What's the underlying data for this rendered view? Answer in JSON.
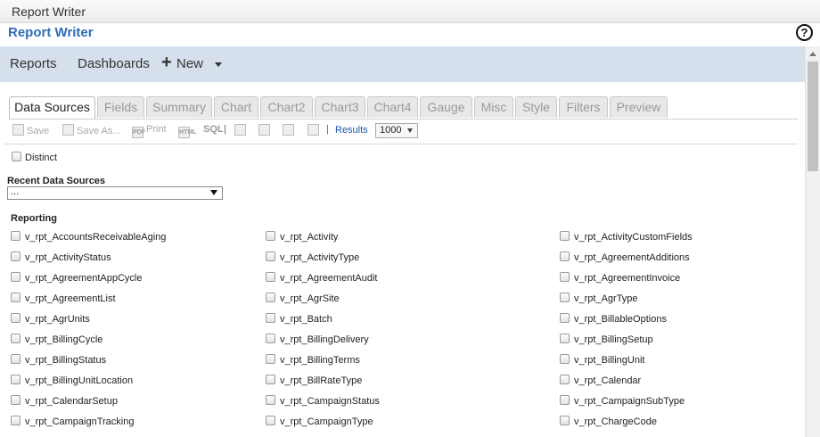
{
  "window": {
    "title": "Report Writer"
  },
  "app": {
    "title": "Report Writer",
    "help_glyph": "?"
  },
  "nav": {
    "reports": "Reports",
    "dashboards": "Dashboards",
    "new_plus": "+",
    "new": "New"
  },
  "tabs": [
    "Data Sources",
    "Fields",
    "Summary",
    "Chart",
    "Chart2",
    "Chart3",
    "Chart4",
    "Gauge",
    "Misc",
    "Style",
    "Filters",
    "Preview"
  ],
  "active_tab": "Data Sources",
  "toolbar": {
    "save": "Save",
    "save_as": "Save As...",
    "print": "Print",
    "sql": "SQL",
    "pdf": "PDF",
    "html": "HTML",
    "separator": "|",
    "results": "Results",
    "results_value": "1000"
  },
  "distinct": {
    "label": "Distinct"
  },
  "recent": {
    "label": "Recent Data Sources",
    "value": "..."
  },
  "reporting": {
    "label": "Reporting",
    "col1": [
      "v_rpt_AccountsReceivableAging",
      "v_rpt_ActivityStatus",
      "v_rpt_AgreementAppCycle",
      "v_rpt_AgreementList",
      "v_rpt_AgrUnits",
      "v_rpt_BillingCycle",
      "v_rpt_BillingStatus",
      "v_rpt_BillingUnitLocation",
      "v_rpt_CalendarSetup",
      "v_rpt_CampaignTracking"
    ],
    "col2": [
      "v_rpt_Activity",
      "v_rpt_ActivityType",
      "v_rpt_AgreementAudit",
      "v_rpt_AgrSite",
      "v_rpt_Batch",
      "v_rpt_BillingDelivery",
      "v_rpt_BillingTerms",
      "v_rpt_BillRateType",
      "v_rpt_CampaignStatus",
      "v_rpt_CampaignType"
    ],
    "col3": [
      "v_rpt_ActivityCustomFields",
      "v_rpt_AgreementAdditions",
      "v_rpt_AgreementInvoice",
      "v_rpt_AgrType",
      "v_rpt_BillableOptions",
      "v_rpt_BillingSetup",
      "v_rpt_BillingUnit",
      "v_rpt_Calendar",
      "v_rpt_CampaignSubType",
      "v_rpt_ChargeCode"
    ]
  },
  "colors": {
    "accent": "#2f6db5",
    "navbar": "#d5e0ec",
    "link": "#1b55a4"
  }
}
